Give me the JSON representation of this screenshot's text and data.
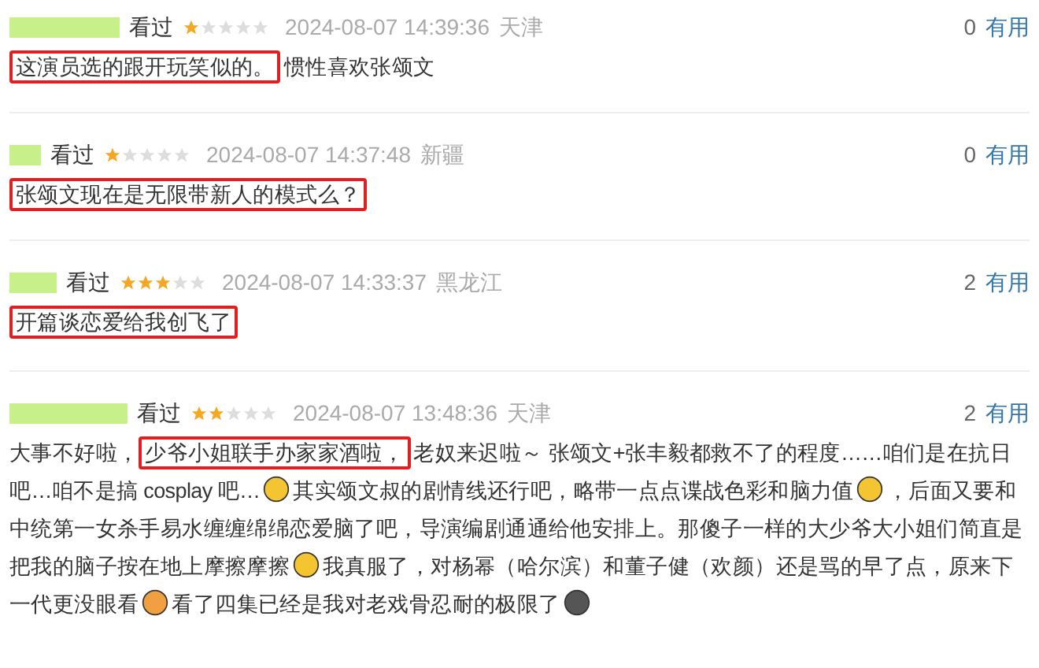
{
  "comments": [
    {
      "status": "看过",
      "stars": 1,
      "time": "2024-08-07 14:39:36",
      "location": "天津",
      "votes": "0",
      "useful": "有用",
      "segments": [
        {
          "kind": "highlight",
          "text": "这演员选的跟开玩笑似的。"
        },
        {
          "kind": "text",
          "text": "惯性喜欢张颂文"
        }
      ]
    },
    {
      "status": "看过",
      "stars": 1,
      "time": "2024-08-07 14:37:48",
      "location": "新疆",
      "votes": "0",
      "useful": "有用",
      "segments": [
        {
          "kind": "highlight",
          "text": "张颂文现在是无限带新人的模式么？"
        }
      ]
    },
    {
      "status": "看过",
      "stars": 3,
      "time": "2024-08-07 14:33:37",
      "location": "黑龙江",
      "votes": "2",
      "useful": "有用",
      "segments": [
        {
          "kind": "highlight",
          "text": "开篇谈恋爱给我创飞了"
        }
      ]
    },
    {
      "status": "看过",
      "stars": 2,
      "time": "2024-08-07 13:48:36",
      "location": "天津",
      "votes": "2",
      "useful": "有用",
      "segments": [
        {
          "kind": "text",
          "text": "大事不好啦，"
        },
        {
          "kind": "highlight",
          "text": "少爷小姐联手办家家酒啦，"
        },
        {
          "kind": "text",
          "text": "老奴来迟啦～ 张颂文+张丰毅都救不了的程度……咱们是在抗日"
        },
        {
          "kind": "text",
          "text": "吧…咱不是搞 cosplay 吧…"
        },
        {
          "kind": "emoji",
          "color": "#f5c531"
        },
        {
          "kind": "text",
          "text": "其实颂文叔的剧情线还行吧，略带一点点谍战色彩和脑力值"
        },
        {
          "kind": "emoji",
          "color": "#f5c531"
        },
        {
          "kind": "text",
          "text": "，后面又要和"
        },
        {
          "kind": "text",
          "text": "中统第一女杀手易水缠缠绵绵恋爱脑了吧，导演编剧通通给他安排上。那傻子一样的大少爷大小姐们简直是"
        },
        {
          "kind": "text",
          "text": "把我的脑子按在地上摩擦摩擦"
        },
        {
          "kind": "emoji",
          "color": "#f5c531"
        },
        {
          "kind": "text",
          "text": "我真服了，对杨幂（哈尔滨）和董子健（欢颜）还是骂的早了点，原来下"
        },
        {
          "kind": "text",
          "text": "一代更没眼看"
        },
        {
          "kind": "emoji",
          "color": "#f0a040"
        },
        {
          "kind": "text",
          "text": "看了四集已经是我对老戏骨忍耐的极限了"
        },
        {
          "kind": "emoji",
          "color": "#555555"
        }
      ]
    }
  ]
}
